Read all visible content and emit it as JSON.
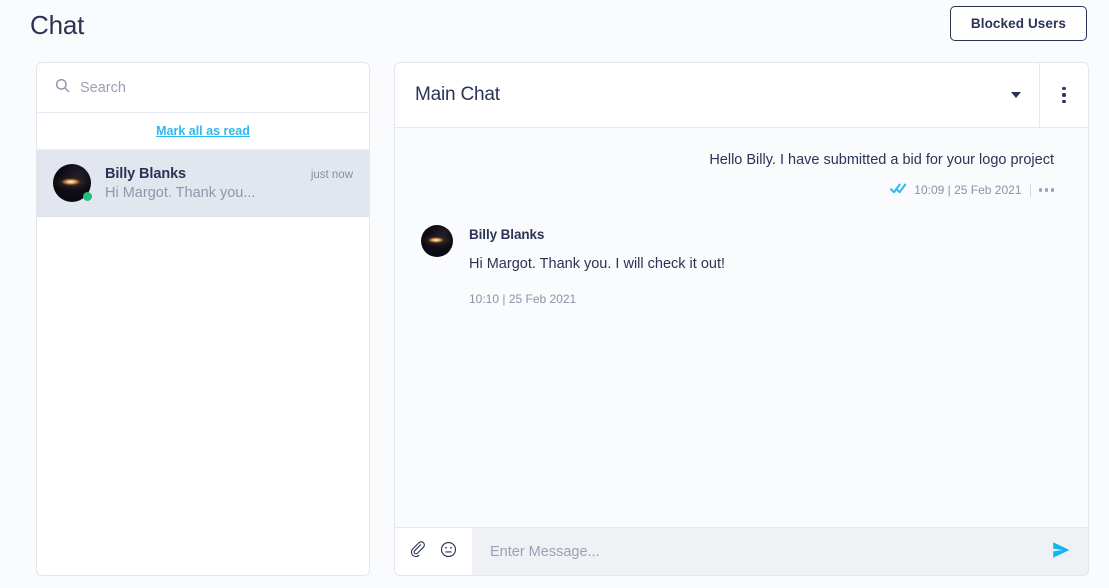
{
  "header": {
    "title": "Chat",
    "blocked_users_label": "Blocked Users"
  },
  "sidebar": {
    "search": {
      "placeholder": "Search",
      "value": "",
      "icon": "search-icon"
    },
    "mark_all_label": "Mark all as read",
    "conversations": [
      {
        "name": "Billy Blanks",
        "preview": "Hi Margot. Thank you...",
        "time": "just now",
        "online": true,
        "selected": true
      }
    ]
  },
  "chat": {
    "title": "Main Chat",
    "dropdown_icon": "chevron-down-icon",
    "menu_icon": "kebab-menu-icon",
    "messages": [
      {
        "direction": "sent",
        "text": "Hello Billy. I have submitted a bid for your logo project",
        "time": "10:09 | 25 Feb 2021",
        "read_status": "read",
        "read_icon": "double-check-icon",
        "options_icon": "more-options-icon"
      },
      {
        "direction": "received",
        "author": "Billy Blanks",
        "text": "Hi Margot. Thank you. I will check it out!",
        "time": "10:10 | 25 Feb 2021"
      }
    ],
    "composer": {
      "placeholder": "Enter Message...",
      "value": "",
      "attach_icon": "paperclip-icon",
      "emoji_icon": "emoji-smiley-icon",
      "send_icon": "send-icon"
    }
  },
  "colors": {
    "accent": "#2cb8f0",
    "text_primary": "#2b3457",
    "text_muted": "#9097ab",
    "online": "#21c177",
    "selected_row": "#e2e6ef"
  }
}
